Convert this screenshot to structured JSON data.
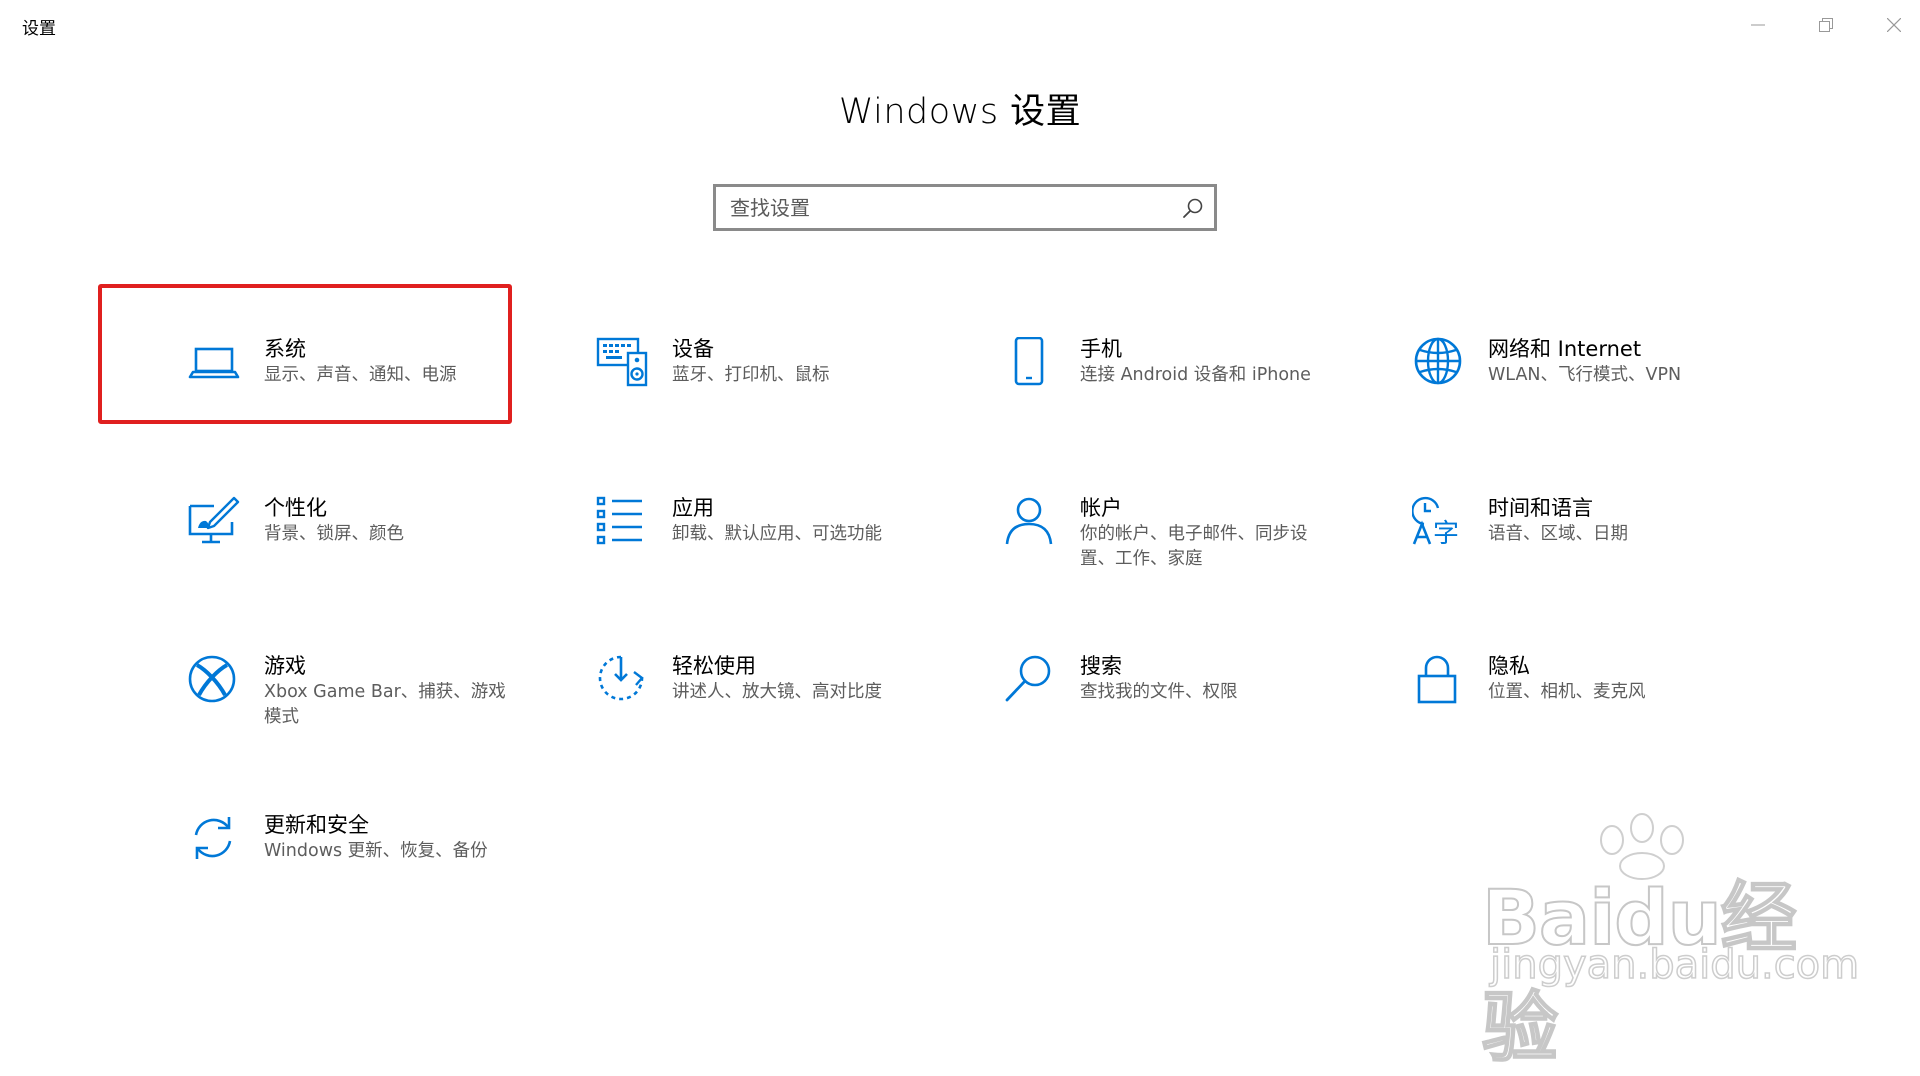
{
  "window": {
    "title": "设置",
    "controls": {
      "minimize": "minimize-icon",
      "maximize": "restore-icon",
      "close": "close-icon"
    }
  },
  "page": {
    "title": "Windows 设置"
  },
  "search": {
    "placeholder": "查找设置",
    "value": ""
  },
  "colors": {
    "accent": "#0078D7",
    "highlight_border": "#E0201F",
    "description_text": "#5D5D5D"
  },
  "tiles": [
    {
      "id": "system",
      "icon": "laptop-icon",
      "title": "系统",
      "description": "显示、声音、通知、电源"
    },
    {
      "id": "devices",
      "icon": "keyboard-speaker-icon",
      "title": "设备",
      "description": "蓝牙、打印机、鼠标"
    },
    {
      "id": "phone",
      "icon": "phone-icon",
      "title": "手机",
      "description": "连接 Android 设备和 iPhone"
    },
    {
      "id": "network",
      "icon": "globe-icon",
      "title": "网络和 Internet",
      "description": "WLAN、飞行模式、VPN"
    },
    {
      "id": "personalization",
      "icon": "paint-brush-icon",
      "title": "个性化",
      "description": "背景、锁屏、颜色"
    },
    {
      "id": "apps",
      "icon": "app-list-icon",
      "title": "应用",
      "description": "卸载、默认应用、可选功能"
    },
    {
      "id": "accounts",
      "icon": "person-icon",
      "title": "帐户",
      "description": "你的帐户、电子邮件、同步设置、工作、家庭"
    },
    {
      "id": "time-language",
      "icon": "clock-language-icon",
      "title": "时间和语言",
      "description": "语音、区域、日期"
    },
    {
      "id": "gaming",
      "icon": "xbox-icon",
      "title": "游戏",
      "description": "Xbox Game Bar、捕获、游戏模式"
    },
    {
      "id": "ease-of-access",
      "icon": "ease-of-access-timer-icon",
      "title": "轻松使用",
      "description": "讲述人、放大镜、高对比度"
    },
    {
      "id": "search",
      "icon": "magnifier-icon",
      "title": "搜索",
      "description": "查找我的文件、权限"
    },
    {
      "id": "privacy",
      "icon": "lock-icon",
      "title": "隐私",
      "description": "位置、相机、麦克风"
    },
    {
      "id": "update-security",
      "icon": "refresh-icon",
      "title": "更新和安全",
      "description": "Windows 更新、恢复、备份"
    }
  ],
  "watermark": {
    "line1": "Baidu经验",
    "line2": "jingyan.baidu.com"
  }
}
